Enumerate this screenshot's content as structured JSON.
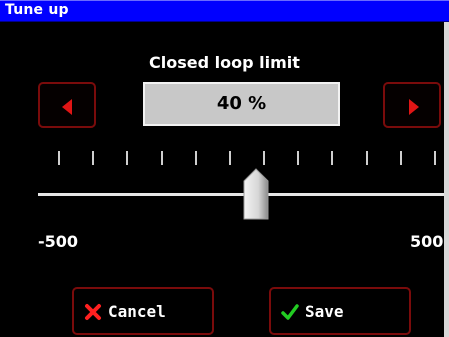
{
  "window": {
    "title": "Tune up"
  },
  "setting": {
    "label": "Closed loop limit",
    "value_text": "40 %",
    "value_percent": 40
  },
  "slider": {
    "min_label": "-500",
    "max_label": "500",
    "min": -500,
    "max": 500,
    "tick_count": 12
  },
  "buttons": {
    "cancel_label": "Cancel",
    "save_label": "Save"
  },
  "icons": {
    "decrease": "left-arrow-icon",
    "increase": "right-arrow-icon",
    "cancel": "x-mark-icon",
    "save": "check-mark-icon"
  },
  "colors": {
    "titlebar": "#0000ff",
    "button_border": "#7a0b0b",
    "arrow": "#e01515",
    "cancel_icon": "#ff2020",
    "save_icon": "#22cc22"
  }
}
